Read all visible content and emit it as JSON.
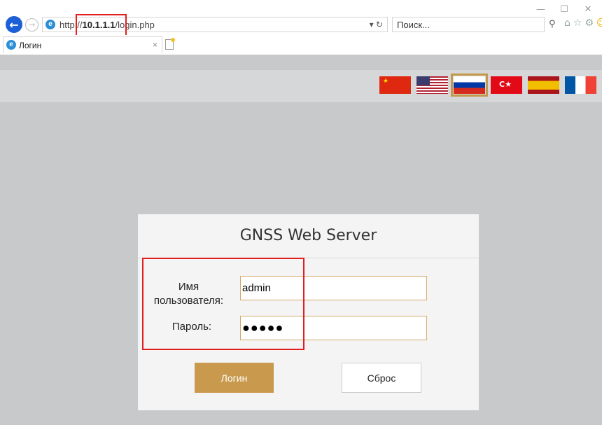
{
  "browser": {
    "url_prefix": "http://",
    "url_host": "10.1.1.1",
    "url_path": "/login.php",
    "refresh_glyph": "▾ ↻",
    "search_placeholder": "Поиск...",
    "search_icon": "search-icon",
    "tab_title": "Логин",
    "tab_close": "×",
    "window_controls": {
      "minimize": "—",
      "maximize": "☐",
      "close": "✕"
    },
    "tools": {
      "home": "⌂",
      "favorites": "☆",
      "settings": "⚙",
      "feedback": "☺"
    },
    "nav": {
      "back": "←",
      "forward": "→"
    }
  },
  "page": {
    "languages": [
      {
        "code": "zh",
        "selected": false
      },
      {
        "code": "en",
        "selected": false
      },
      {
        "code": "ru",
        "selected": true
      },
      {
        "code": "tr",
        "selected": false
      },
      {
        "code": "es",
        "selected": false
      },
      {
        "code": "fr",
        "selected": false
      }
    ],
    "login": {
      "title": "GNSS Web Server",
      "username_label_line1": "Имя",
      "username_label_line2": "пользователя:",
      "username_value": "admin",
      "password_label": "Пароль:",
      "password_value": "●●●●●",
      "login_button": "Логин",
      "reset_button": "Сброс"
    },
    "colors": {
      "accent": "#c99a4d",
      "highlight": "#e02020",
      "background": "#c8c9cb"
    }
  }
}
